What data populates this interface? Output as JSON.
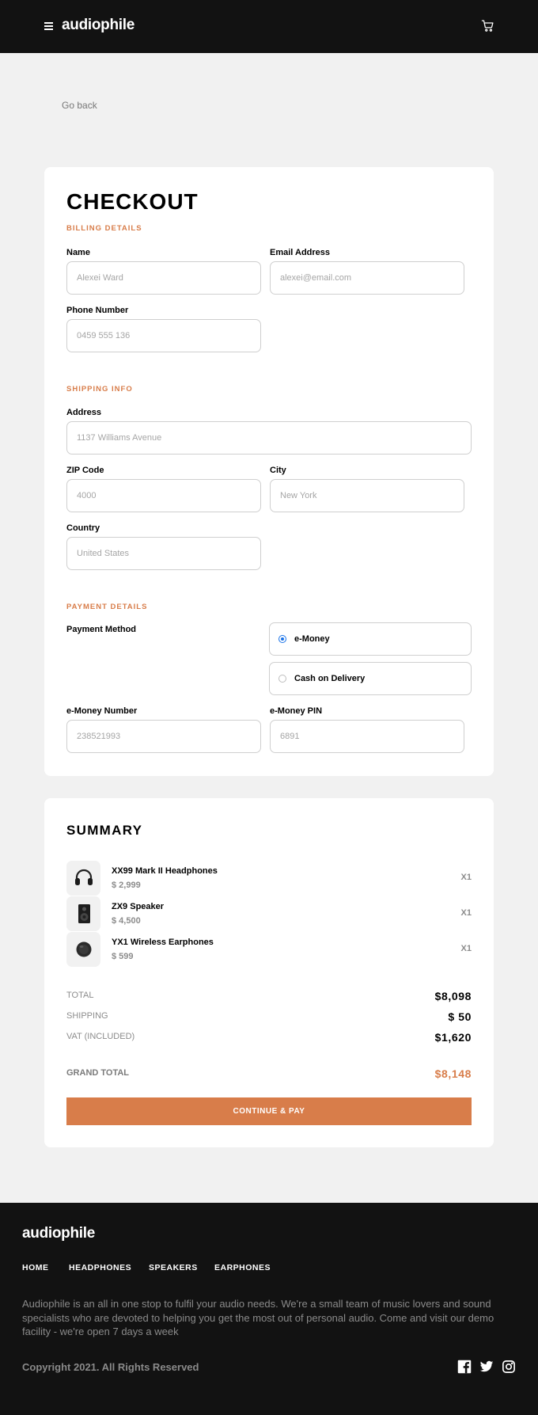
{
  "header": {
    "logo": "audiophile",
    "menu_icon": "hamburger-menu-icon",
    "cart_icon": "shopping-cart-icon"
  },
  "go_back": "Go back",
  "checkout": {
    "title": "CHECKOUT",
    "billing": {
      "heading": "BILLING DETAILS",
      "name_label": "Name",
      "name_placeholder": "Alexei Ward",
      "email_label": "Email Address",
      "email_placeholder": "alexei@email.com",
      "phone_label": "Phone Number",
      "phone_placeholder": "0459 555 136"
    },
    "shipping": {
      "heading": "SHIPPING INFO",
      "address_label": "Address",
      "address_placeholder": "1137 Williams Avenue",
      "zip_label": "ZIP Code",
      "zip_placeholder": "4000",
      "city_label": "City",
      "city_placeholder": "New York",
      "country_label": "Country",
      "country_placeholder": "United States"
    },
    "payment": {
      "heading": "PAYMENT DETAILS",
      "method_label": "Payment Method",
      "options": [
        {
          "label": "e-Money",
          "selected": true
        },
        {
          "label": "Cash on Delivery",
          "selected": false
        }
      ],
      "emoney_number_label": "e-Money Number",
      "emoney_number_placeholder": "238521993",
      "emoney_pin_label": "e-Money PIN",
      "emoney_pin_placeholder": "6891"
    }
  },
  "summary": {
    "title": "SUMMARY",
    "items": [
      {
        "name": "XX99 Mark II Headphones",
        "price": "$ 2,999",
        "qty": "X1",
        "icon": "headphones-icon"
      },
      {
        "name": "ZX9 Speaker",
        "price": "$ 4,500",
        "qty": "X1",
        "icon": "speaker-icon"
      },
      {
        "name": "YX1 Wireless Earphones",
        "price": "$ 599",
        "qty": "X1",
        "icon": "earphones-icon"
      }
    ],
    "total_label": "TOTAL",
    "total_value": "$8,098",
    "shipping_label": "SHIPPING",
    "shipping_value": "$ 50",
    "vat_label": "VAT (INCLUDED)",
    "vat_value": "$1,620",
    "grand_total_label": "GRAND TOTAL",
    "grand_total_value": "$8,148",
    "pay_button": "CONTINUE & PAY"
  },
  "footer": {
    "logo": "audiophile",
    "nav": [
      "HOME",
      "HEADPHONES",
      "SPEAKERS",
      "EARPHONES"
    ],
    "description": "Audiophile is an all in one stop to fulfil your audio needs. We're a small team of music lovers and sound specialists who are devoted to helping you get the most out of personal audio. Come and visit our demo facility - we're open 7 days a week",
    "copyright": "Copyright 2021. All Rights Reserved",
    "social_icons": [
      "facebook-icon",
      "twitter-icon",
      "instagram-icon"
    ]
  },
  "colors": {
    "accent": "#d87d4a",
    "dark": "#121212",
    "background": "#f1f1f1"
  }
}
